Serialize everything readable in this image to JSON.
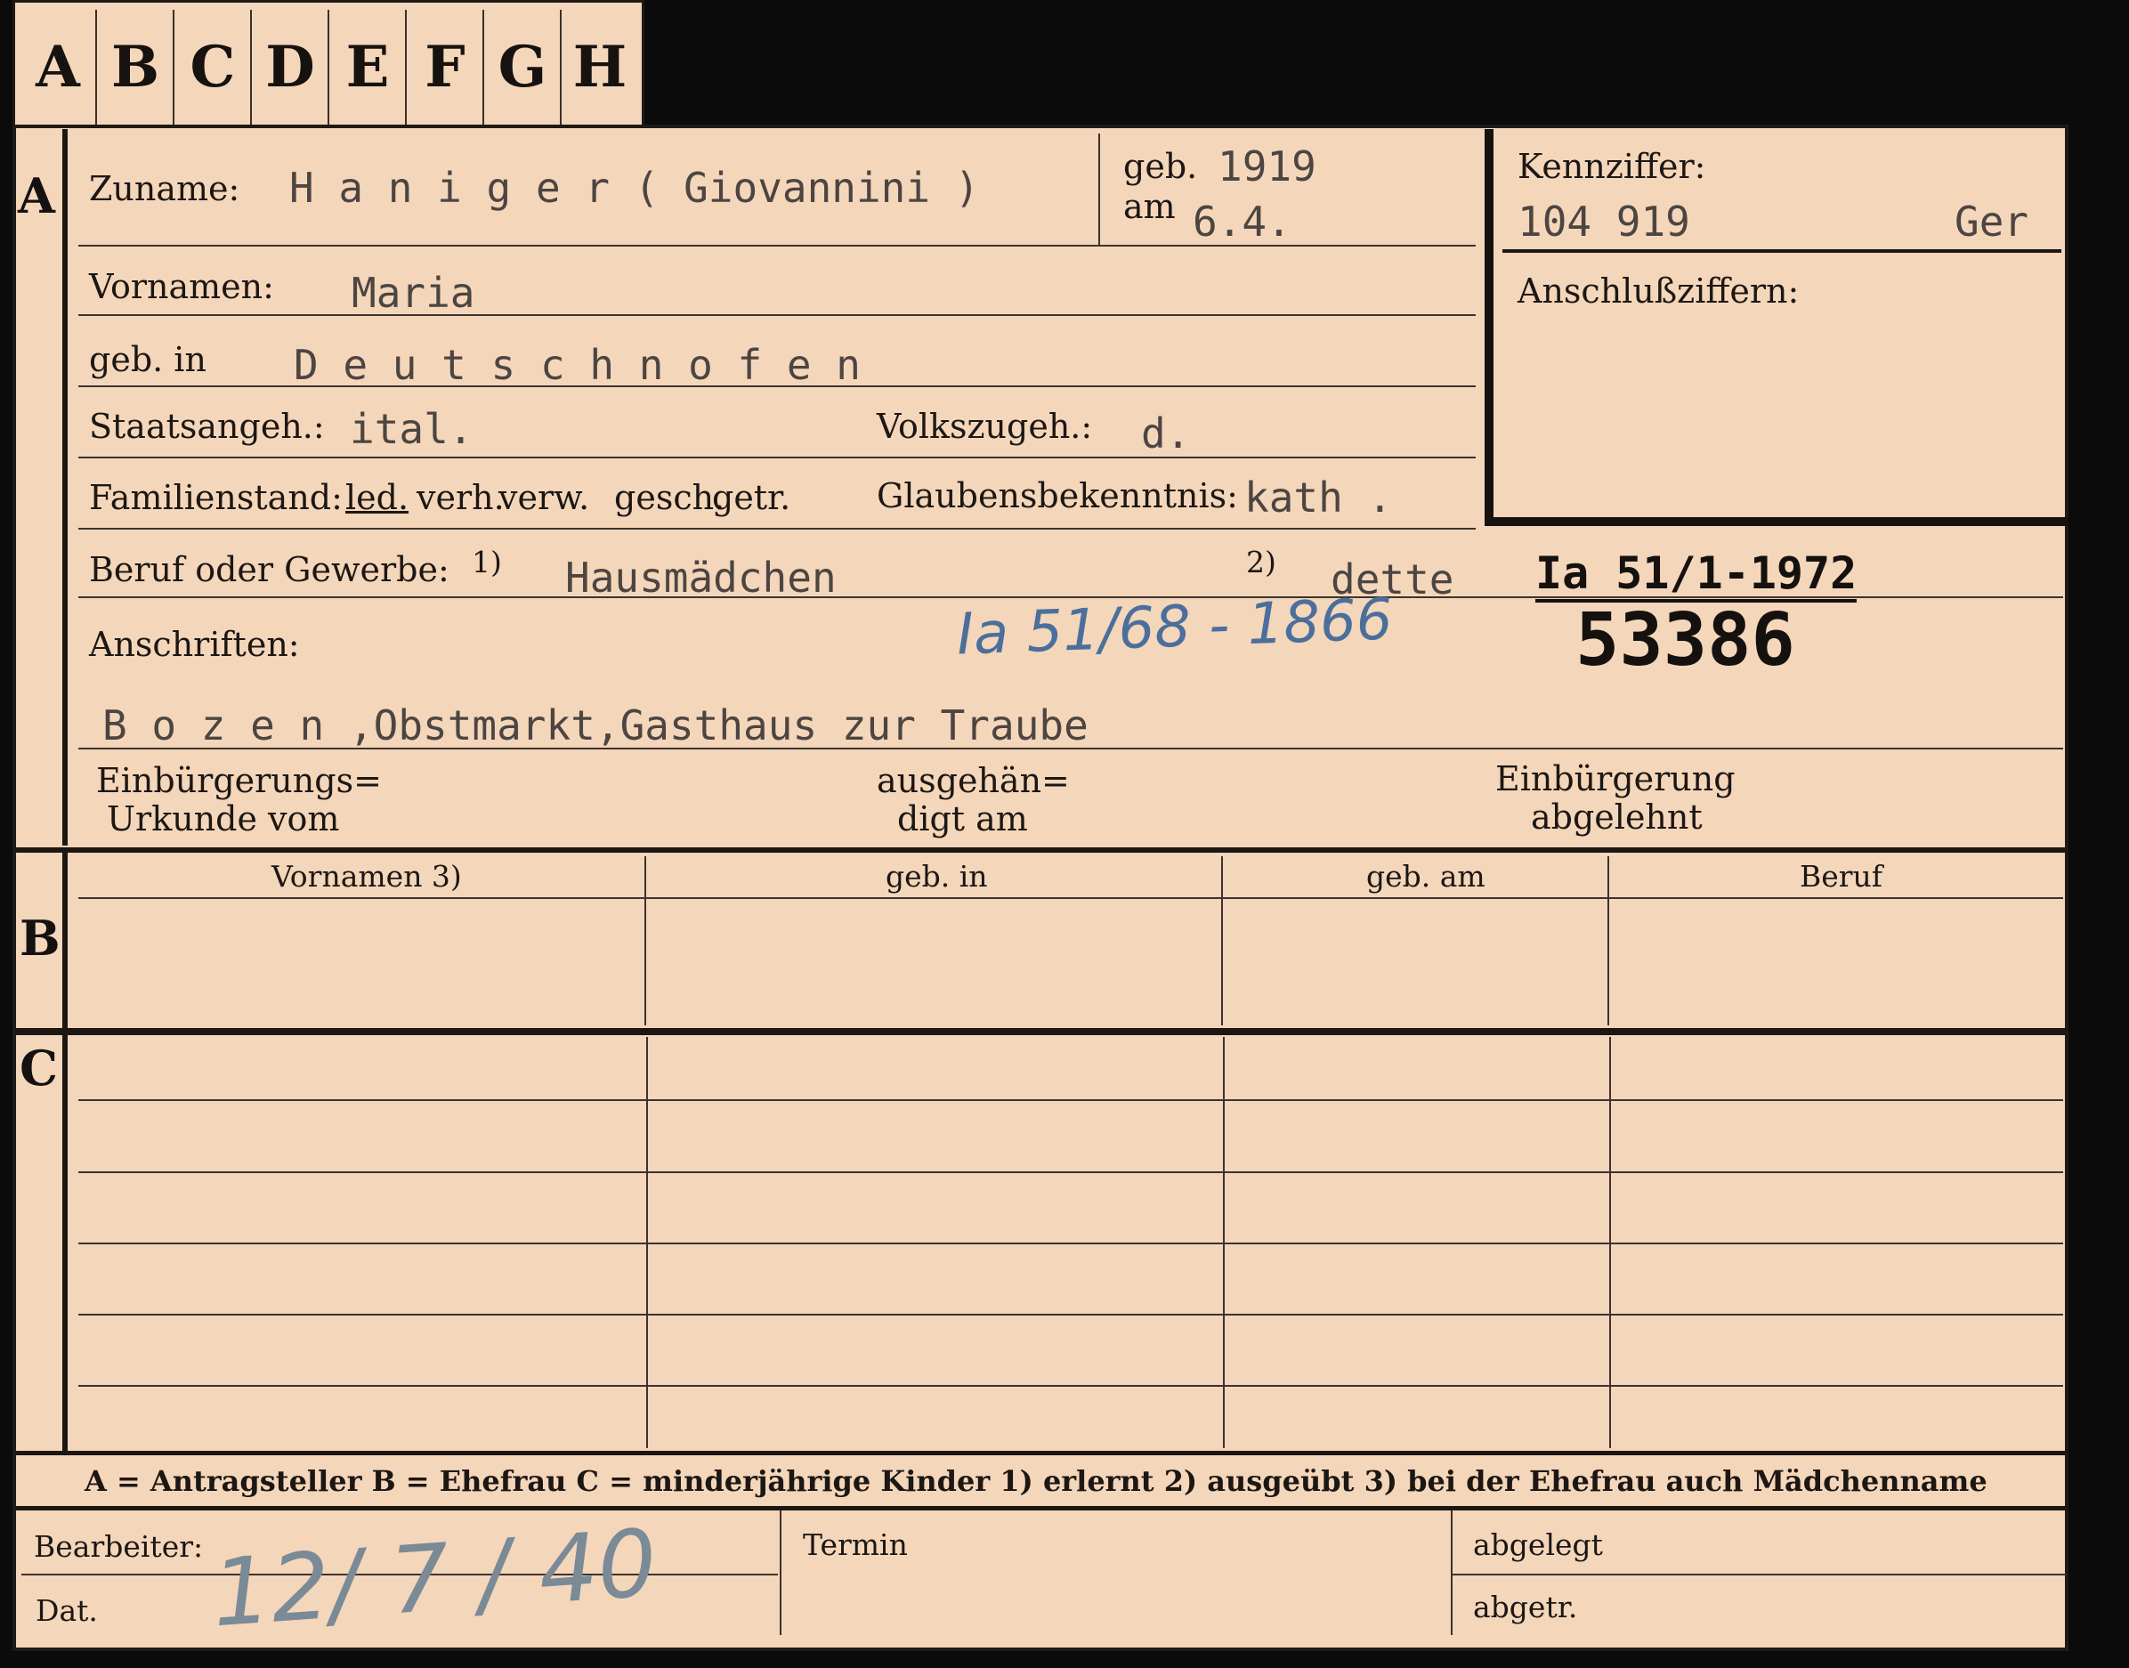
{
  "tabs": [
    "A",
    "B",
    "C",
    "D",
    "E",
    "F",
    "G",
    "H"
  ],
  "sections": {
    "a": "A",
    "b": "B",
    "c": "C"
  },
  "person": {
    "zuname_label": "Zuname:",
    "zuname_value": "H a n i g e r  ( Giovannini )",
    "geb_label": "geb.",
    "geb_year": "1919",
    "am_label": "am",
    "am_value": "6.4.",
    "vornamen_label": "Vornamen:",
    "vornamen_value": "Maria",
    "gebin_label": "geb. in",
    "gebin_value": "D e u t s c h n o f e n",
    "staats_label": "Staatsangeh.:",
    "staats_value": "ital.",
    "volks_label": "Volkszugeh.:",
    "volks_value": "d.",
    "familien_label": "Familienstand:",
    "familien_options": [
      "led.",
      "verh.",
      "verw.",
      "gesch.",
      "getr."
    ],
    "glauben_label": "Glaubensbekenntnis:",
    "glauben_value": "kath .",
    "beruf_label": "Beruf oder Gewerbe:",
    "beruf_sup1": "1)",
    "beruf_value": "Hausmädchen",
    "beruf_sup2": "2)",
    "beruf_value2": "dette",
    "anschriften_label": "Anschriften:",
    "anschriften_value": "B o z e n ,Obstmarkt,Gasthaus zur Traube",
    "einb1_a": "Einbürgerungs=",
    "einb1_b": "Urkunde vom",
    "einb2_a": "ausgehän=",
    "einb2_b": "digt am",
    "einb3_a": "Einbürgerung",
    "einb3_b": "abgelehnt"
  },
  "kennziffer": {
    "label": "Kennziffer:",
    "value": "104 919",
    "suffix": "Ger",
    "anschluss_label": "Anschlußziffern:"
  },
  "stamps": {
    "file_ref": "Ia 51/1-1972",
    "number": "53386",
    "handwritten_ref": "Ia 51/68 - 1866"
  },
  "table": {
    "headers": [
      "Vornamen 3)",
      "geb. in",
      "geb. am",
      "Beruf"
    ]
  },
  "legend": {
    "text": "A = Antragsteller   B = Ehefrau   C = minderjährige Kinder   1) erlernt   2) ausgeübt   3) bei der Ehefrau auch Mädchenname"
  },
  "footer": {
    "bearbeiter_label": "Bearbeiter:",
    "dat_label": "Dat.",
    "dat_value": "12/ 7 / 40",
    "termin_label": "Termin",
    "abgelegt_label": "abgelegt",
    "abgetr_label": "abgetr."
  }
}
